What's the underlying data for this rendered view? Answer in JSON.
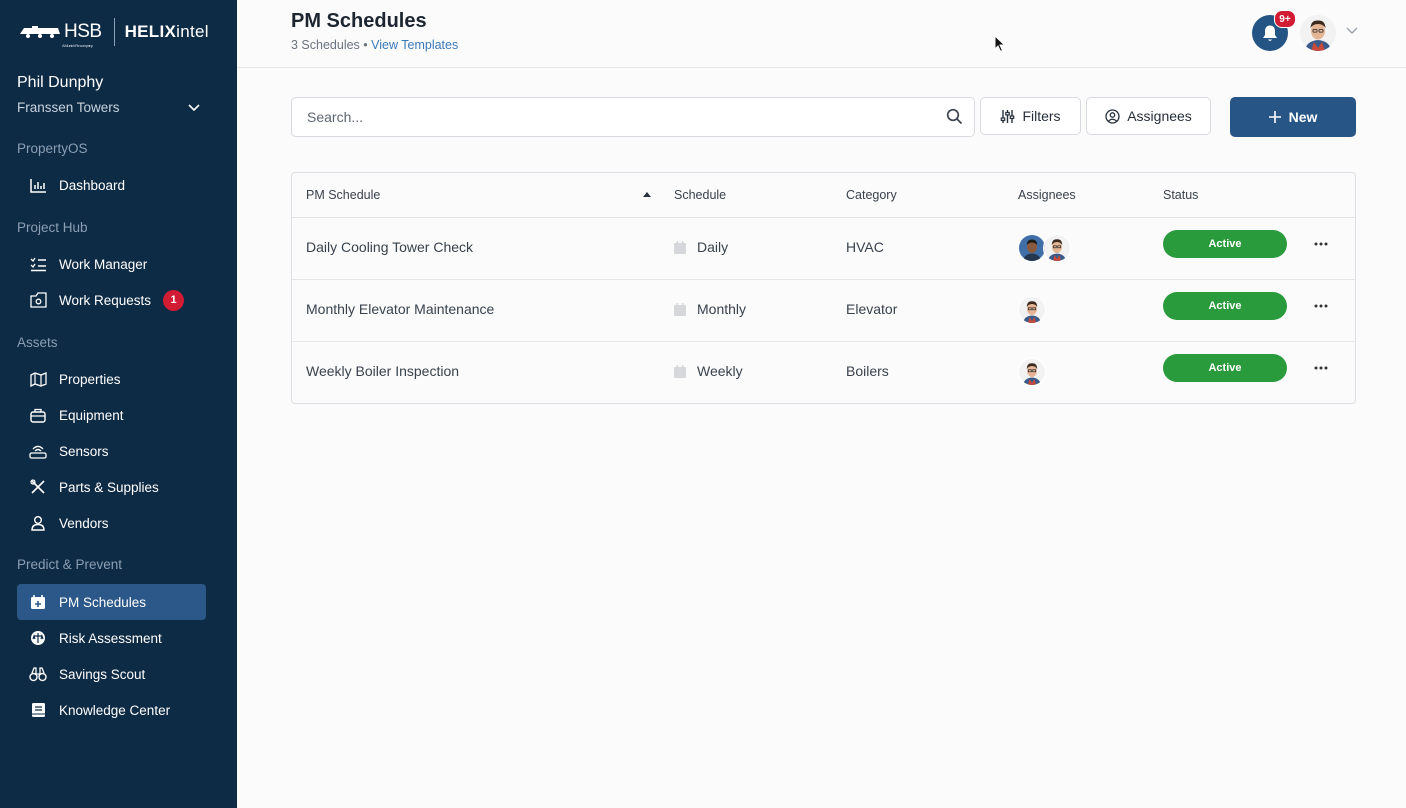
{
  "sidebar": {
    "logo_hsb": "HSB",
    "logo_hsb_sub": "A Munich Re company",
    "logo_helix_bold": "HELIX",
    "logo_helix_light": "intel",
    "user_name": "Phil Dunphy",
    "site_name": "Franssen Towers",
    "sections": {
      "propertyos": "PropertyOS",
      "project_hub": "Project Hub",
      "assets": "Assets",
      "predict": "Predict & Prevent"
    },
    "items": {
      "dashboard": "Dashboard",
      "work_manager": "Work Manager",
      "work_requests": "Work Requests",
      "work_requests_badge": "1",
      "properties": "Properties",
      "equipment": "Equipment",
      "sensors": "Sensors",
      "parts": "Parts & Supplies",
      "vendors": "Vendors",
      "pm_schedules": "PM Schedules",
      "risk": "Risk Assessment",
      "savings": "Savings Scout",
      "knowledge": "Knowledge Center"
    }
  },
  "header": {
    "title": "PM Schedules",
    "count": "3 Schedules",
    "separator": " • ",
    "templates_link": "View Templates",
    "notif_badge": "9+"
  },
  "toolbar": {
    "search_placeholder": "Search...",
    "filters": "Filters",
    "assignees": "Assignees",
    "new": "New"
  },
  "table": {
    "headers": {
      "name": "PM Schedule",
      "schedule": "Schedule",
      "category": "Category",
      "assignees": "Assignees",
      "status": "Status"
    },
    "rows": [
      {
        "name": "Daily Cooling Tower Check",
        "schedule": "Daily",
        "category": "HVAC",
        "status": "Active"
      },
      {
        "name": "Monthly Elevator Maintenance",
        "schedule": "Monthly",
        "category": "Elevator",
        "status": "Active"
      },
      {
        "name": "Weekly Boiler Inspection",
        "schedule": "Weekly",
        "category": "Boilers",
        "status": "Active"
      }
    ]
  },
  "colors": {
    "sidebar_bg": "#0e2b45",
    "active_nav": "#2b5888",
    "primary": "#265586",
    "status_active": "#2a9b3c",
    "badge": "#d11c33"
  }
}
